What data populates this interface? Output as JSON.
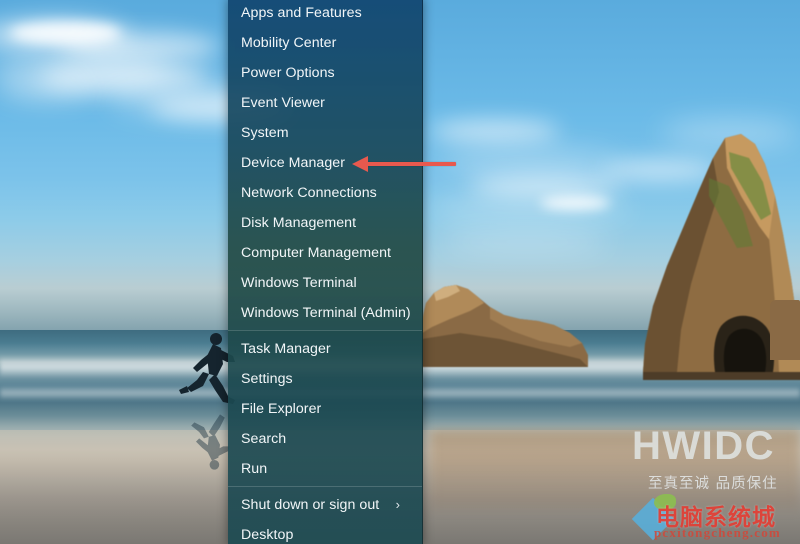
{
  "desktop": {
    "wallpaper_name": "wharariki-beach-wallpaper",
    "sky_color": "#6cbbe8",
    "sea_color": "#4e7688",
    "sand_color": "#cdc6b7"
  },
  "winx_menu": {
    "name": "win-x-power-user-menu",
    "background_color": "#1a4a5a",
    "text_color": "#f2f6f8",
    "items": [
      {
        "label": "Apps and Features",
        "has_submenu": false
      },
      {
        "label": "Mobility Center",
        "has_submenu": false
      },
      {
        "label": "Power Options",
        "has_submenu": false
      },
      {
        "label": "Event Viewer",
        "has_submenu": false
      },
      {
        "label": "System",
        "has_submenu": false
      },
      {
        "label": "Device Manager",
        "has_submenu": false
      },
      {
        "label": "Network Connections",
        "has_submenu": false
      },
      {
        "label": "Disk Management",
        "has_submenu": false
      },
      {
        "label": "Computer Management",
        "has_submenu": false
      },
      {
        "label": "Windows Terminal",
        "has_submenu": false
      },
      {
        "label": "Windows Terminal (Admin)",
        "has_submenu": false
      },
      {
        "label": "Task Manager",
        "has_submenu": false
      },
      {
        "label": "Settings",
        "has_submenu": false
      },
      {
        "label": "File Explorer",
        "has_submenu": false
      },
      {
        "label": "Search",
        "has_submenu": false
      },
      {
        "label": "Run",
        "has_submenu": false
      },
      {
        "label": "Shut down or sign out",
        "has_submenu": true,
        "submenu_glyph": "›"
      },
      {
        "label": "Desktop",
        "has_submenu": false
      }
    ],
    "separator_after_indices": [
      10,
      15
    ]
  },
  "annotation": {
    "arrow_name": "red-pointer-arrow",
    "arrow_color": "#e8594e",
    "points_at": "Device Manager"
  },
  "watermark": {
    "brand": "HWIDC",
    "slogan": "至真至诚 品质保住",
    "site_name": "电脑系统城",
    "site_url": "pcxitongcheng.com",
    "brand_color": "#e4eaec",
    "site_name_color": "#e13c32"
  }
}
